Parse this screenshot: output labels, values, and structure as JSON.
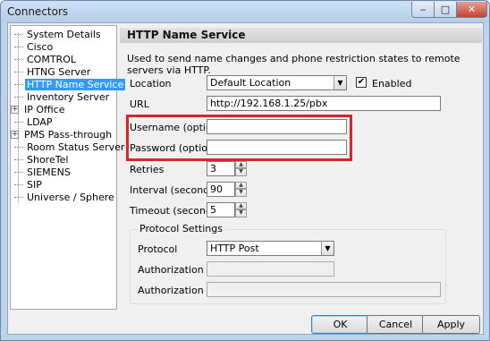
{
  "window": {
    "title": "Connectors",
    "minimize_glyph": "‒",
    "maximize_glyph": "□",
    "close_glyph": "✕"
  },
  "tree": {
    "items": [
      {
        "label": "System Details",
        "expandable": false,
        "selected": false
      },
      {
        "label": "Cisco",
        "expandable": false,
        "selected": false
      },
      {
        "label": "COMTROL",
        "expandable": false,
        "selected": false
      },
      {
        "label": "HTNG Server",
        "expandable": false,
        "selected": false
      },
      {
        "label": "HTTP Name Service",
        "expandable": false,
        "selected": true
      },
      {
        "label": "Inventory Server",
        "expandable": false,
        "selected": false
      },
      {
        "label": "IP Office",
        "expandable": true,
        "selected": false
      },
      {
        "label": "LDAP",
        "expandable": false,
        "selected": false
      },
      {
        "label": "PMS Pass-through",
        "expandable": true,
        "selected": false
      },
      {
        "label": "Room Status Server",
        "expandable": false,
        "selected": false
      },
      {
        "label": "ShoreTel",
        "expandable": false,
        "selected": false
      },
      {
        "label": "SIEMENS",
        "expandable": false,
        "selected": false
      },
      {
        "label": "SIP",
        "expandable": false,
        "selected": false
      },
      {
        "label": "Universe / Sphere",
        "expandable": false,
        "selected": false
      }
    ],
    "expand_glyph": "+"
  },
  "panel": {
    "header": "HTTP Name Service",
    "description": "Used to send name changes and phone restriction states to remote servers via HTTP.",
    "location": {
      "label": "Location",
      "value": "Default Location"
    },
    "enabled": {
      "label": "Enabled",
      "checked": true,
      "check_glyph": "✔"
    },
    "url": {
      "label": "URL",
      "value": "http://192.168.1.25/pbx"
    },
    "username": {
      "label": "Username (optional)",
      "value": ""
    },
    "password": {
      "label": "Password (optional)",
      "value": ""
    },
    "retries": {
      "label": "Retries",
      "value": "3"
    },
    "interval": {
      "label": "Interval (seconds)",
      "value": "90"
    },
    "timeout": {
      "label": "Timeout (seconds)",
      "value": "5"
    },
    "protocol_settings": {
      "title": "Protocol Settings",
      "protocol": {
        "label": "Protocol",
        "value": "HTTP Post"
      },
      "authorization_id": {
        "label": "Authorization ID",
        "value": ""
      },
      "authorization_key": {
        "label": "Authorization Key",
        "value": ""
      }
    },
    "dropdown_glyph": "▼",
    "spin_up_glyph": "▲",
    "spin_down_glyph": "▼"
  },
  "footer": {
    "ok": "OK",
    "cancel": "Cancel",
    "apply": "Apply"
  },
  "colors": {
    "highlight_border": "#d7262d",
    "selection": "#3399ff",
    "window_frame": "#bcd4ec"
  }
}
